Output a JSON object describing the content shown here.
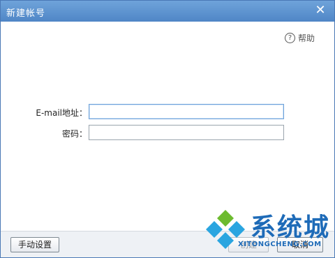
{
  "window": {
    "title": "新建帐号",
    "close_symbol": "✕"
  },
  "help": {
    "icon_text": "?",
    "label": "帮助"
  },
  "form": {
    "email_label": "E-mail地址：",
    "email_value": "",
    "password_label": "密码：",
    "password_value": ""
  },
  "footer": {
    "manual_label": "手动设置",
    "create_label": "创建",
    "cancel_label": "取消"
  },
  "watermark": {
    "text": "系统城",
    "sub": "XITONGCHENG.COM",
    "colors": {
      "blue": "#1e6bb8",
      "green": "#6dbb2f",
      "sky": "#2aa5e0"
    }
  }
}
